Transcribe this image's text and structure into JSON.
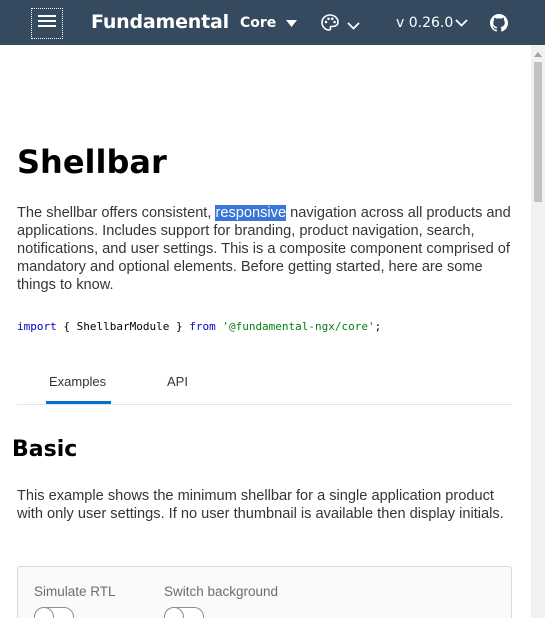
{
  "header": {
    "brand": "Fundamental",
    "library": "Core",
    "version": "v 0.26.0",
    "background_color": "#354a5f"
  },
  "page": {
    "title": "Shellbar",
    "intro_before": "The shellbar offers consistent, ",
    "intro_highlight": "responsive",
    "intro_after": " navigation across all products and applications. Includes support for branding, product navigation, search, notifications, and user settings. This is a composite component comprised of mandatory and optional elements. Before getting started, here are some things to know.",
    "import_kw": "import",
    "import_mid": " { ShellbarModule } ",
    "from_kw": "from",
    "import_path": " '@fundamental-ngx/core'",
    "import_end": ";"
  },
  "tabs": [
    {
      "label": "Examples",
      "selected": true
    },
    {
      "label": "API",
      "selected": false
    }
  ],
  "section": {
    "title": "Basic",
    "description": "This example shows the minimum shellbar for a single application product with only user settings. If no user thumbnail is available then display initials."
  },
  "options": {
    "rtl_label": "Simulate RTL",
    "background_label": "Switch background"
  },
  "icons": [
    "menu-icon",
    "caret-down-icon",
    "palette-icon",
    "chevron-down-icon",
    "github-icon"
  ],
  "colors": {
    "accent": "#0a6ed1",
    "highlight": "#3a76d8"
  }
}
